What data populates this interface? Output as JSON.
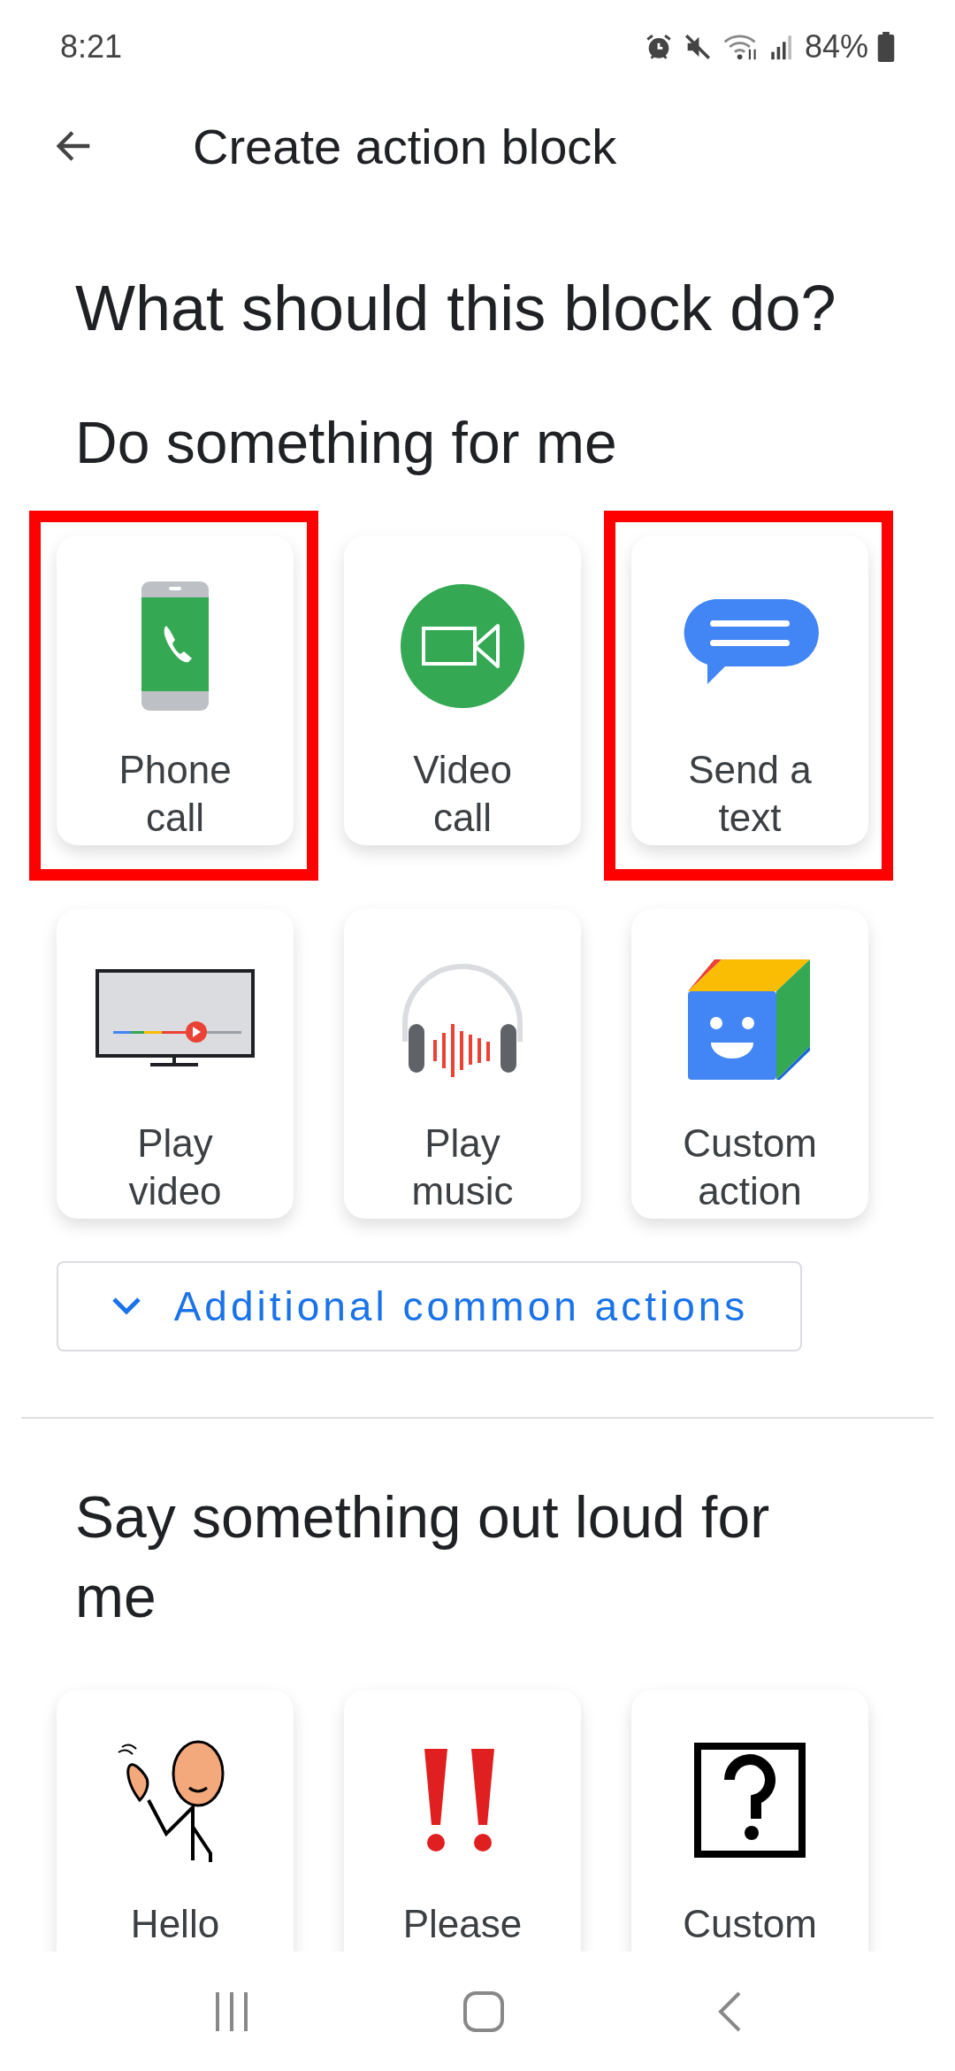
{
  "status_bar": {
    "time": "8:21",
    "battery": "84%"
  },
  "header": {
    "title": "Create action block"
  },
  "heading": "What should this block do?",
  "sections": [
    {
      "title": "Do something for me",
      "tiles": [
        {
          "kind": "phone",
          "label": "Phone call",
          "highlighted": true
        },
        {
          "kind": "video-call",
          "label": "Video call",
          "highlighted": false
        },
        {
          "kind": "message",
          "label": "Send a text",
          "highlighted": true
        },
        {
          "kind": "tv",
          "label": "Play video",
          "highlighted": false
        },
        {
          "kind": "headphones",
          "label": "Play music",
          "highlighted": false
        },
        {
          "kind": "cube",
          "label": "Custom action",
          "highlighted": false
        }
      ],
      "expand_button": {
        "label": "Additional common actions"
      }
    },
    {
      "title": "Say something out loud for me",
      "tiles": [
        {
          "kind": "wave",
          "label": "Hello",
          "highlighted": false
        },
        {
          "kind": "exclaim",
          "label": "Please",
          "highlighted": false
        },
        {
          "kind": "question",
          "label": "Custom",
          "highlighted": false
        }
      ]
    }
  ]
}
